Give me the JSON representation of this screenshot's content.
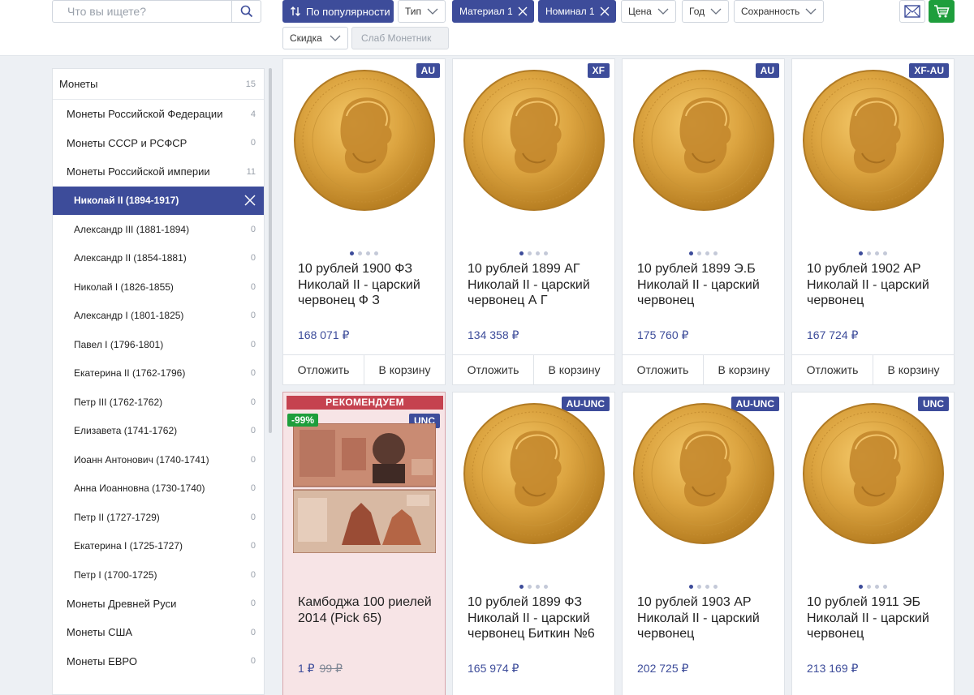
{
  "search": {
    "placeholder": "Что вы ищете?"
  },
  "filters": {
    "sort": "По популярности",
    "type": "Тип",
    "material": "Материал 1",
    "nominal": "Номинал 1",
    "price": "Цена",
    "year": "Год",
    "condition": "Сохранность",
    "discount": "Скидка",
    "slab": "Слаб Монетник"
  },
  "sidebar": {
    "items": [
      {
        "label": "Монеты",
        "count": "15"
      },
      {
        "label": "Монеты Российской Федерации",
        "count": "4"
      },
      {
        "label": "Монеты СССР и РСФСР",
        "count": "0"
      },
      {
        "label": "Монеты Российской империи",
        "count": "11"
      },
      {
        "label": "Николай II (1894-1917)",
        "count": ""
      },
      {
        "label": "Александр III (1881-1894)",
        "count": "0"
      },
      {
        "label": "Александр II (1854-1881)",
        "count": "0"
      },
      {
        "label": "Николай I (1826-1855)",
        "count": "0"
      },
      {
        "label": "Александр I (1801-1825)",
        "count": "0"
      },
      {
        "label": "Павел I (1796-1801)",
        "count": "0"
      },
      {
        "label": "Екатерина II (1762-1796)",
        "count": "0"
      },
      {
        "label": "Петр III (1762-1762)",
        "count": "0"
      },
      {
        "label": "Елизавета (1741-1762)",
        "count": "0"
      },
      {
        "label": "Иоанн Антонович (1740-1741)",
        "count": "0"
      },
      {
        "label": "Анна Иоанновна (1730-1740)",
        "count": "0"
      },
      {
        "label": "Петр II (1727-1729)",
        "count": "0"
      },
      {
        "label": "Екатерина I (1725-1727)",
        "count": "0"
      },
      {
        "label": "Петр I (1700-1725)",
        "count": "0"
      },
      {
        "label": "Монеты Древней Руси",
        "count": "0"
      },
      {
        "label": "Монеты США",
        "count": "0"
      },
      {
        "label": "Монеты ЕВРО",
        "count": "0"
      }
    ]
  },
  "card_actions": {
    "defer": "Отложить",
    "cart": "В корзину"
  },
  "products": [
    {
      "grade": "AU",
      "title": "10 рублей 1900 ФЗ Николай II - царский червонец Ф З",
      "price": "168 071 ₽"
    },
    {
      "grade": "XF",
      "title": "10 рублей 1899 АГ Николай II - царский червонец А Г",
      "price": "134 358 ₽"
    },
    {
      "grade": "AU",
      "title": "10 рублей 1899 Э.Б Николай II - царский червонец",
      "price": "175 760 ₽"
    },
    {
      "grade": "XF-AU",
      "title": "10 рублей 1902 АР Николай II - царский червонец",
      "price": "167 724 ₽"
    },
    {
      "grade": "UNC",
      "title": "Камбоджа 100 риелей 2014 (Pick 65)",
      "price": "1 ₽",
      "old_price": "99 ₽",
      "recommend": "РЕКОМЕНДУЕМ",
      "discount": "-99%"
    },
    {
      "grade": "AU-UNC",
      "title": "10 рублей 1899 ФЗ Николай II - царский червонец Биткин №6",
      "price": "165 974 ₽"
    },
    {
      "grade": "AU-UNC",
      "title": "10 рублей 1903 АР Николай II - царский червонец",
      "price": "202 725 ₽"
    },
    {
      "grade": "UNC",
      "title": "10 рублей 1911 ЭБ Николай II - царский червонец",
      "price": "213 169 ₽"
    }
  ],
  "colors": {
    "accent": "#3d4c9a",
    "cart_green": "#1e9e3c",
    "recommend_red": "#c5424f",
    "coin_gold": "#d9a23c"
  }
}
